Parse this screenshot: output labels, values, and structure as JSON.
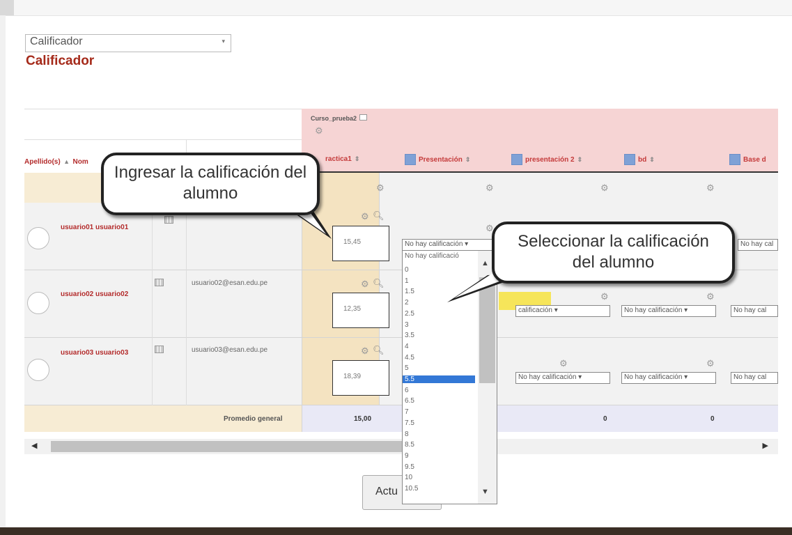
{
  "selector": {
    "value": "Calificador",
    "caret": "▾"
  },
  "page_title": "Calificador",
  "course": {
    "name": "Curso_prueba2"
  },
  "headers": {
    "surname": "Apellido(s)",
    "name": "Nom",
    "items": [
      "ractica1",
      "Presentación",
      "presentación 2",
      "bd",
      "Base d"
    ]
  },
  "students": [
    {
      "name": "usuario01 usuario01",
      "email": "",
      "grade": "15,45"
    },
    {
      "name": "usuario02 usuario02",
      "email": "usuario02@esan.edu.pe",
      "grade": "12,35"
    },
    {
      "name": "usuario03 usuario03",
      "email": "usuario03@esan.edu.pe",
      "grade": "18,39"
    }
  ],
  "no_grade": "No hay calificación",
  "no_grade_short": "No hay cal",
  "no_grade_cut": "No hay calificació",
  "no_grade_row2": "calificación",
  "footer": {
    "label": "Promedio general",
    "values": [
      "15,00",
      "0",
      "0"
    ]
  },
  "dropdown_options": [
    "0",
    "1",
    "1.5",
    "2",
    "2.5",
    "3",
    "3.5",
    "4",
    "4.5",
    "5",
    "5.5",
    "6",
    "6.5",
    "7",
    "7.5",
    "8",
    "8.5",
    "9",
    "9.5",
    "10",
    "10.5"
  ],
  "dropdown_selected": "5.5",
  "update_button": "Actu",
  "callouts": {
    "enter_grade": "Ingresar la calificación del alumno",
    "select_grade": "Seleccionar la calificación del alumno"
  },
  "icons": {
    "gear": "gear-icon",
    "search": "search-icon",
    "sort": "sort-icon"
  }
}
